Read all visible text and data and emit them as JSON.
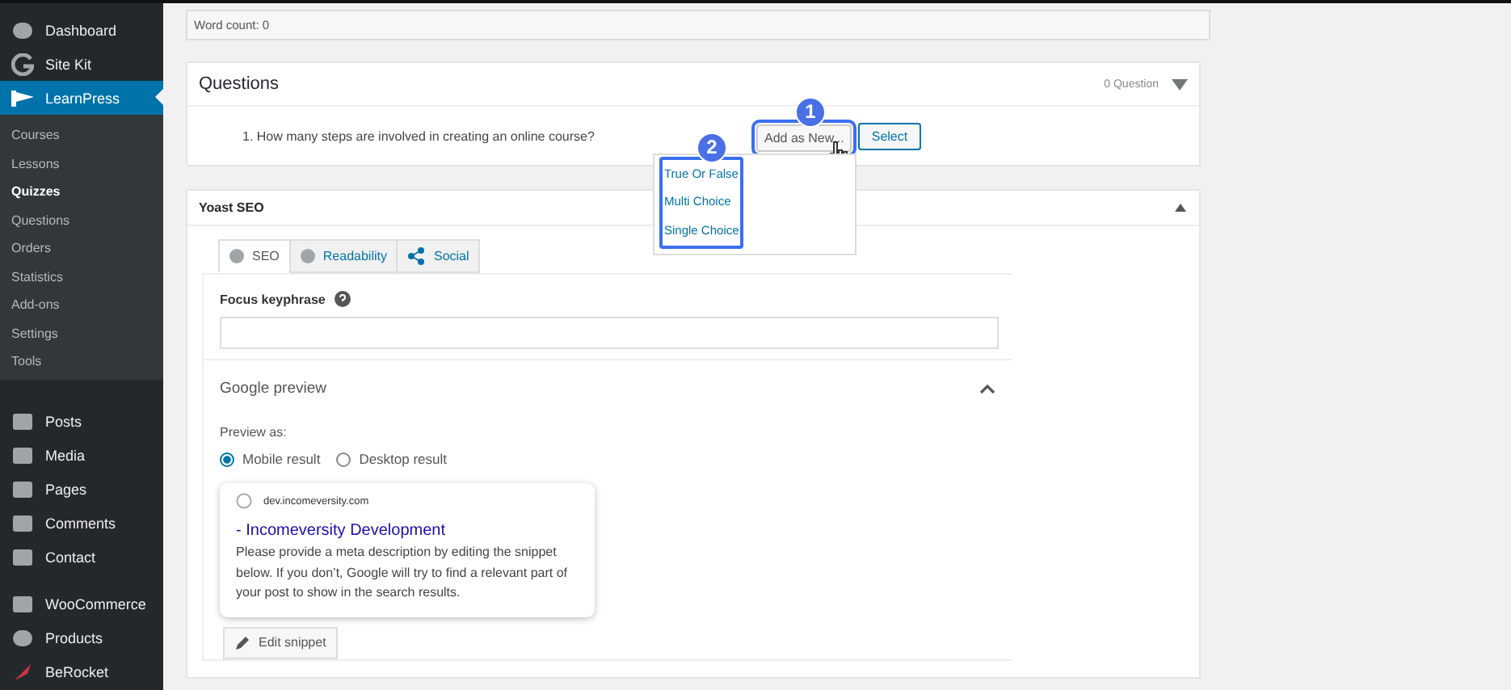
{
  "sidebar": {
    "groups": [
      {
        "items": [
          {
            "label": "Dashboard",
            "selected": false
          },
          {
            "label": "Site Kit",
            "selected": false
          },
          {
            "label": "LearnPress",
            "selected": true,
            "children": [
              {
                "label": "Courses",
                "selected": false
              },
              {
                "label": "Lessons",
                "selected": false
              },
              {
                "label": "Quizzes",
                "selected": true
              },
              {
                "label": "Questions",
                "selected": false
              },
              {
                "label": "Orders",
                "selected": false
              },
              {
                "label": "Statistics",
                "selected": false
              },
              {
                "label": "Add-ons",
                "selected": false
              },
              {
                "label": "Settings",
                "selected": false
              },
              {
                "label": "Tools",
                "selected": false
              }
            ]
          }
        ]
      },
      {
        "items": [
          {
            "label": "Posts",
            "selected": false
          },
          {
            "label": "Media",
            "selected": false
          },
          {
            "label": "Pages",
            "selected": false
          },
          {
            "label": "Comments",
            "selected": false
          },
          {
            "label": "Contact",
            "selected": false
          }
        ]
      },
      {
        "items": [
          {
            "label": "WooCommerce",
            "selected": false
          },
          {
            "label": "Products",
            "selected": false
          },
          {
            "label": "BeRocket",
            "selected": false
          }
        ]
      }
    ]
  },
  "word_count": "Word count: 0",
  "questions": {
    "title": "Questions",
    "count": "0 Question",
    "items": [
      {
        "number": "1.",
        "text": "How many steps are involved in creating an online course?"
      }
    ],
    "buttons": [
      "Add as New...",
      "Select"
    ],
    "dropdown": {
      "items": [
        "True Or False",
        "Multi Choice",
        "Single Choice"
      ]
    },
    "callouts": [
      "1",
      "2"
    ]
  },
  "yoast": {
    "title": "Yoast SEO",
    "tabs": [
      {
        "label": "SEO",
        "selected": true
      },
      {
        "label": "Readability",
        "selected": false
      },
      {
        "label": "Social",
        "selected": false
      }
    ],
    "focus_keyphrase": {
      "label": "Focus keyphrase"
    },
    "google_preview": {
      "title": "Google preview",
      "expanded": true,
      "preview_as": "Preview as:",
      "options": [
        {
          "label": "Mobile result",
          "selected": true
        },
        {
          "label": "Desktop result",
          "selected": false
        }
      ],
      "url": "dev.incomeversity.com",
      "page_title": "- Incomeversity Development",
      "description": "Please provide a meta description by editing the snippet below. If you don’t, Google will try to find a relevant part of your post to show in the search results."
    },
    "edit_button": "Edit snippet"
  }
}
